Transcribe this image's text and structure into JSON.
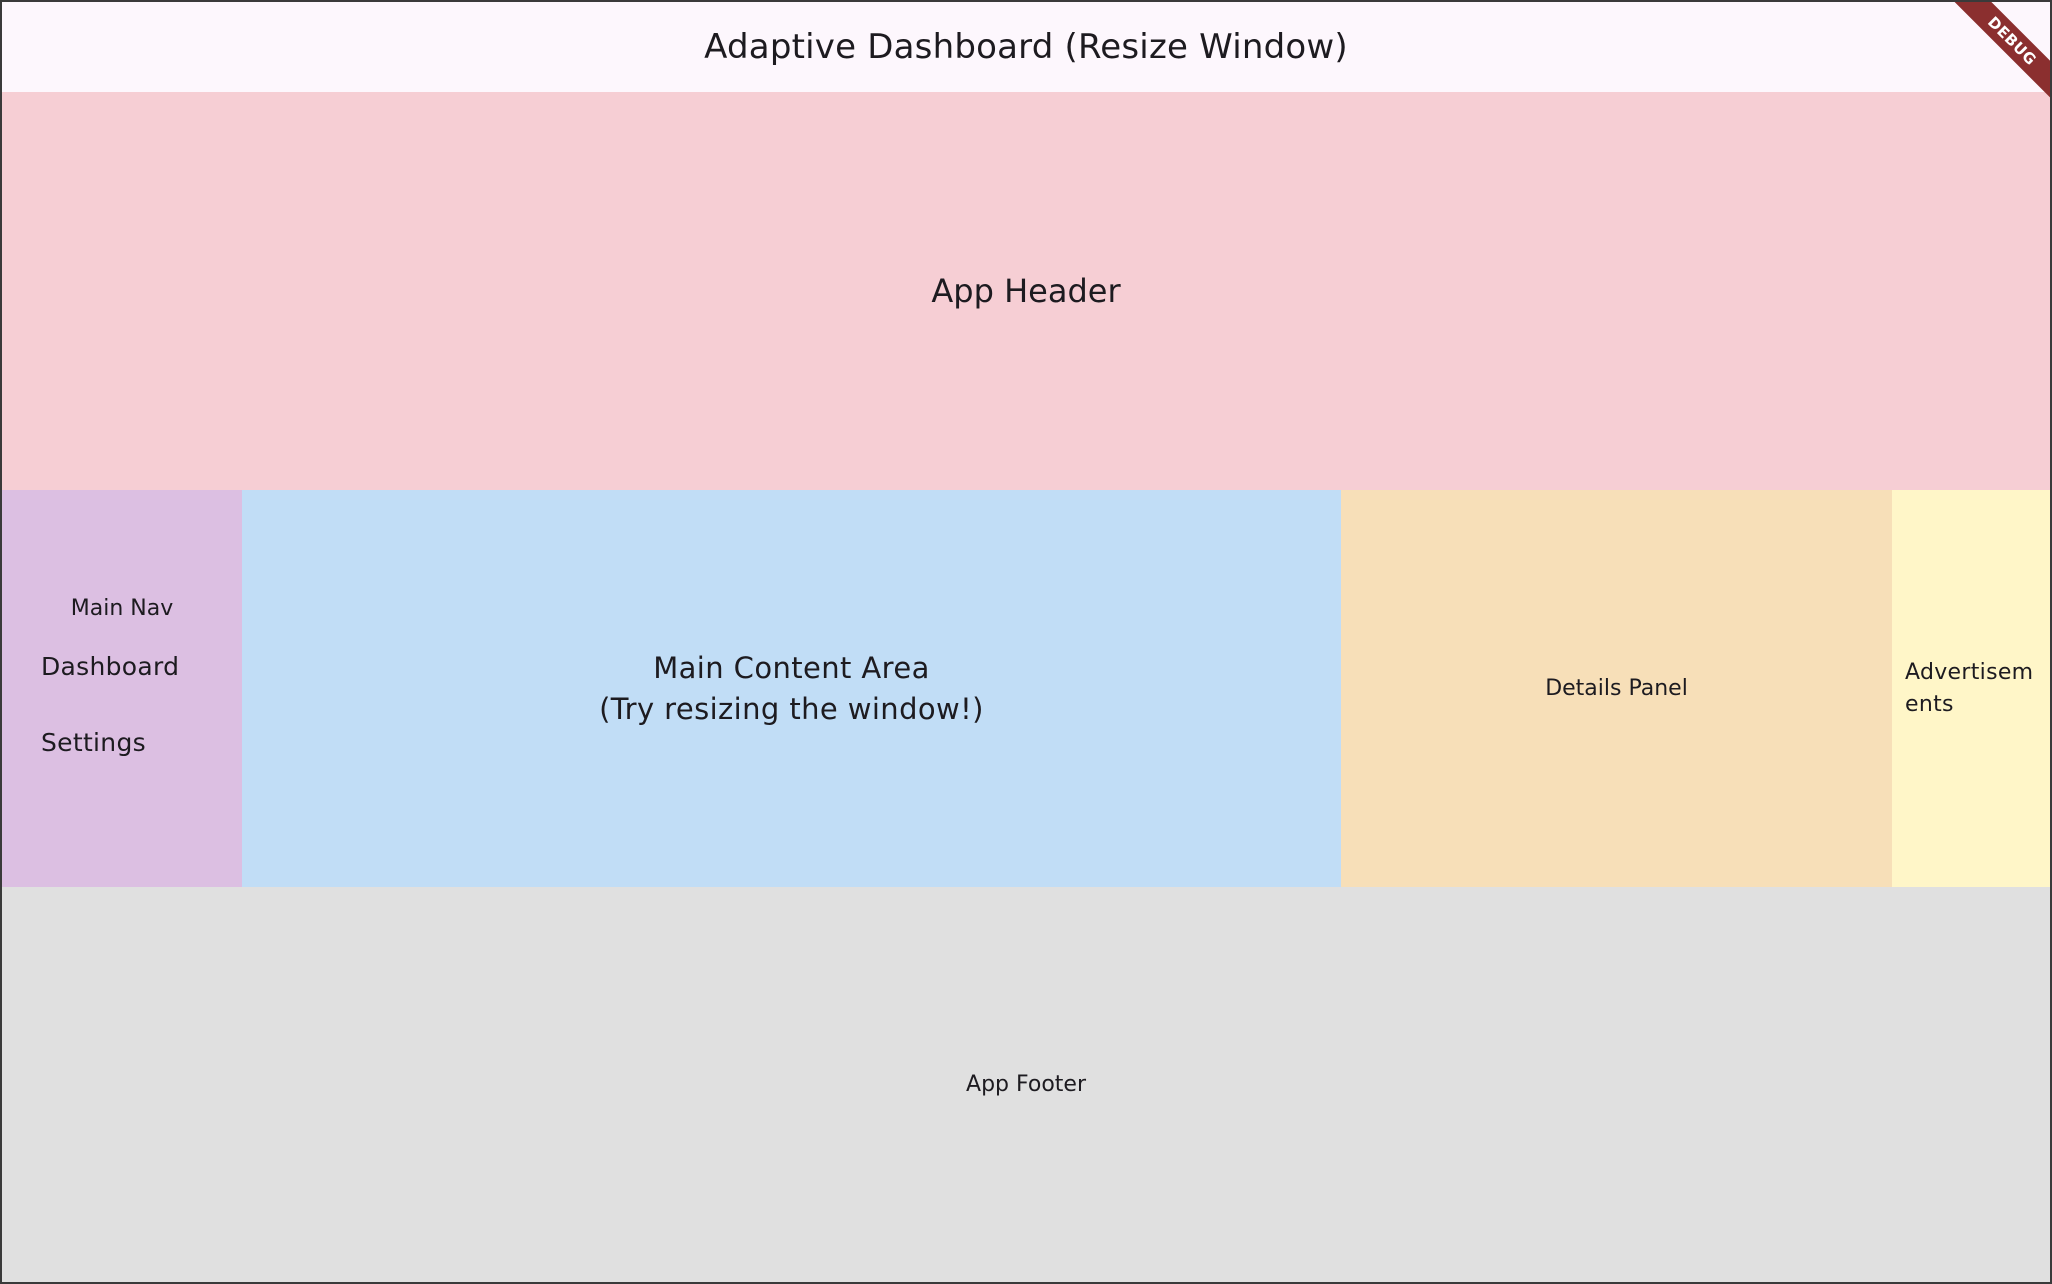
{
  "appbar": {
    "title": "Adaptive Dashboard (Resize Window)"
  },
  "regions": {
    "header": "App Header",
    "nav": {
      "title": "Main Nav",
      "items": [
        {
          "label": "Dashboard"
        },
        {
          "label": "Settings"
        }
      ]
    },
    "main_content": {
      "line1": "Main Content Area",
      "line2": "(Try resizing the window!)"
    },
    "details": "Details Panel",
    "ads": "Advertisements",
    "footer": "App Footer"
  },
  "debug_banner": "DEBUG",
  "colors": {
    "appbar_bg": "#fdf7fd",
    "header_bg": "#f6ced4",
    "nav_bg": "#dcbfe2",
    "main_bg": "#c1ddf6",
    "details_bg": "#f7dfb8",
    "ads_bg": "#fff6c8",
    "footer_bg": "#e0e0e0",
    "debug_ribbon": "#8b2f2f"
  }
}
